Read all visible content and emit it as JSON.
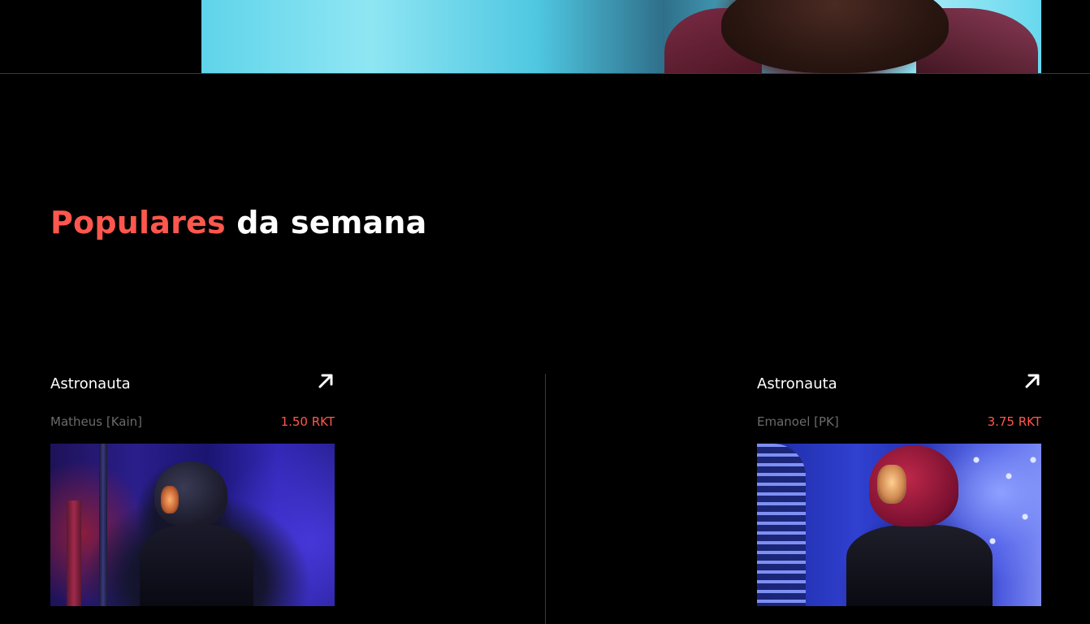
{
  "hero": {
    "image_alt": "Person in hoodie with neon sign"
  },
  "section": {
    "title_accent": "Populares",
    "title_rest": " da semana"
  },
  "cards": [
    {
      "title": "Astronauta",
      "author": "Matheus [Kain]",
      "price": "1.50 RKT",
      "icon": "arrow-up-right-icon"
    },
    {
      "title": "Astronauta",
      "author": "Emanoel [PK]",
      "price": "3.75 RKT",
      "icon": "arrow-up-right-icon"
    }
  ],
  "colors": {
    "background": "#000000",
    "accent": "#ff574d",
    "muted_text": "#6b6b6b",
    "divider": "#3a3a3a"
  }
}
